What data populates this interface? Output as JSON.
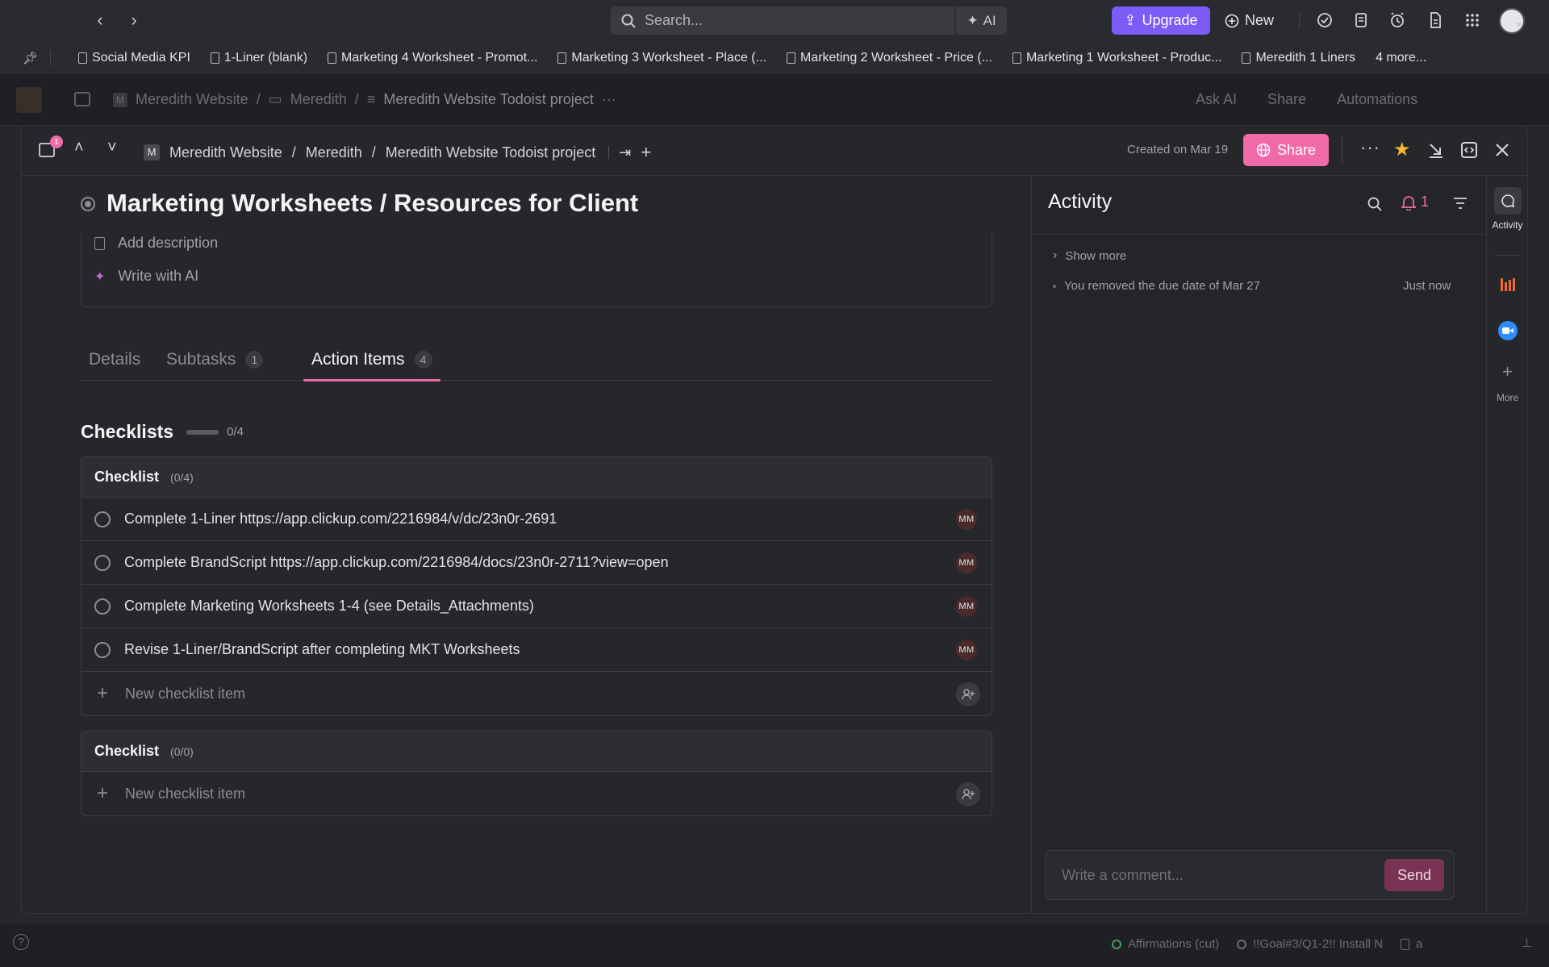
{
  "topbar": {
    "search_placeholder": "Search...",
    "ai_label": "AI",
    "upgrade_label": "Upgrade",
    "new_label": "New"
  },
  "bookmarks": [
    "Social Media KPI",
    "1-Liner (blank)",
    "Marketing 4 Worksheet - Promot...",
    "Marketing 3 Worksheet - Place (...",
    "Marketing 2 Worksheet - Price (...",
    "Marketing 1 Worksheet - Produc...",
    "Meredith 1 Liners"
  ],
  "bookmarks_more": "4 more...",
  "bg_header": {
    "crumb1": "Meredith Website",
    "crumb2": "Meredith",
    "crumb3": "Meredith Website Todoist project",
    "ask_ai": "Ask AI",
    "share": "Share",
    "automations": "Automations"
  },
  "modal": {
    "badge": "1",
    "breadcrumb": [
      "Meredith Website",
      "Meredith",
      "Meredith Website Todoist project"
    ],
    "space_initial": "M",
    "created": "Created on Mar 19",
    "share_label": "Share"
  },
  "task": {
    "title": "Marketing Worksheets / Resources for Client",
    "add_description": "Add description",
    "write_ai": "Write with AI"
  },
  "tabs": [
    {
      "label": "Details",
      "count": ""
    },
    {
      "label": "Subtasks",
      "count": "1"
    },
    {
      "label": "Action Items",
      "count": "4"
    }
  ],
  "checklists": {
    "title": "Checklists",
    "progress": "0/4",
    "progress_fraction": 0,
    "lists": [
      {
        "name": "Checklist",
        "count": "(0/4)",
        "items": [
          {
            "text": "Complete 1-Liner https://app.clickup.com/2216984/v/dc/23n0r-2691",
            "assignee": "MM"
          },
          {
            "text": "Complete BrandScript https://app.clickup.com/2216984/docs/23n0r-2711?view=open",
            "assignee": "MM"
          },
          {
            "text": "Complete Marketing Worksheets 1-4 (see Details_Attachments)",
            "assignee": "MM"
          },
          {
            "text": "Revise 1-Liner/BrandScript after completing MKT Worksheets",
            "assignee": "MM"
          }
        ],
        "new_item": "New checklist item"
      },
      {
        "name": "Checklist",
        "count": "(0/0)",
        "items": [],
        "new_item": "New checklist item"
      }
    ]
  },
  "activity": {
    "title": "Activity",
    "bell_count": "1",
    "show_more": "Show more",
    "event": "You removed the due date of Mar 27",
    "event_time": "Just now",
    "comment_placeholder": "Write a comment...",
    "send_label": "Send"
  },
  "rail": {
    "activity_label": "Activity",
    "more_label": "More"
  },
  "bottom": {
    "item1": "Affirmations (cut)",
    "item2": "!!Goal#3/Q1-2!! Install N",
    "item3": "a"
  },
  "colors": {
    "accent_pink": "#f06aa8",
    "upgrade_purple": "#7b5cf6",
    "send_bg": "#7a3453"
  }
}
